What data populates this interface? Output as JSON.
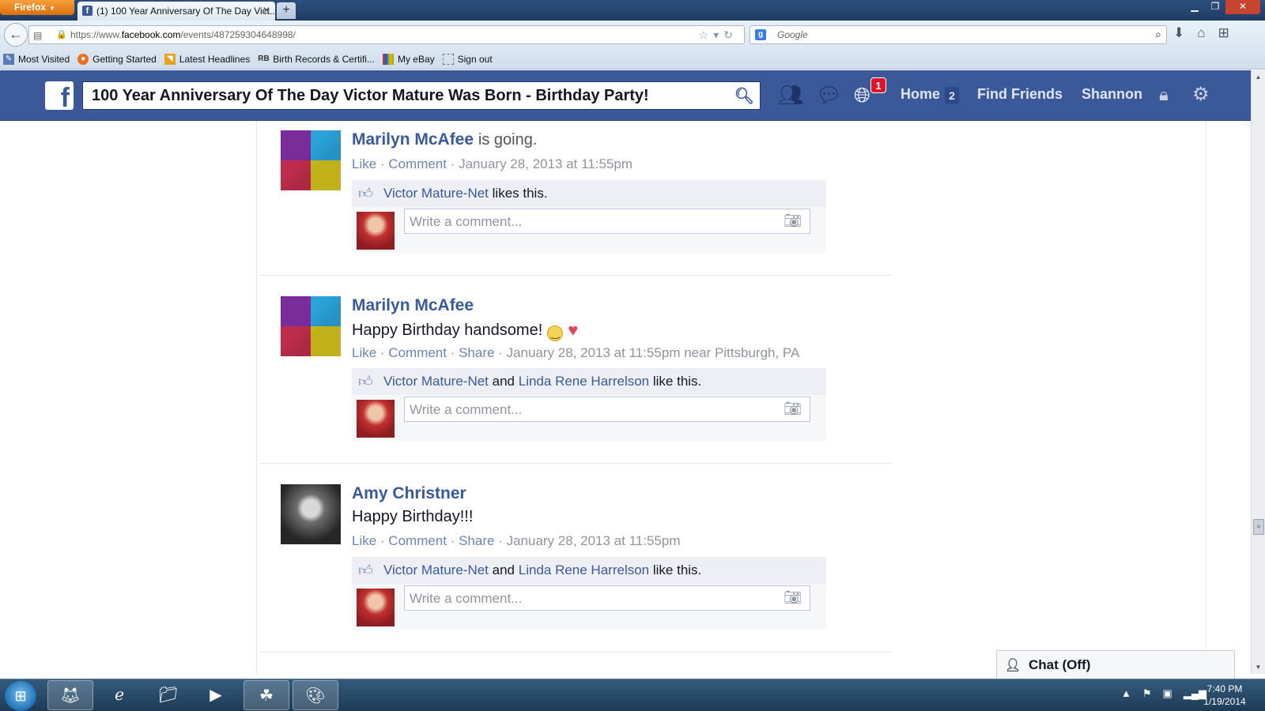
{
  "browser": {
    "menu_label": "Firefox",
    "tab_title": "(1) 100 Year Anniversary Of The Day Vict...",
    "new_tab": "+",
    "url_prefix": "https://www.",
    "url_domain": "facebook.com",
    "url_path": "/events/487259304648998/",
    "search_placeholder": "Google",
    "bookmarks": [
      {
        "label": "Most Visited",
        "icon": "most-visited-icon"
      },
      {
        "label": "Getting Started",
        "icon": "firefox-icon"
      },
      {
        "label": "Latest Headlines",
        "icon": "rss-icon"
      },
      {
        "label": "Birth Records & Certifi...",
        "icon": "rb-icon"
      },
      {
        "label": "My eBay",
        "icon": "ebay-icon"
      },
      {
        "label": "Sign out",
        "icon": "page-icon"
      }
    ]
  },
  "facebook": {
    "search_value": "100 Year Anniversary Of The Day Victor Mature Was Born - Birthday Party!",
    "notif_count": "1",
    "nav": {
      "home": "Home",
      "home_count": "2",
      "find_friends": "Find Friends",
      "profile": "Shannon"
    }
  },
  "posts": [
    {
      "author": "Marilyn McAfee",
      "status_suffix": "is going.",
      "text": "",
      "actions": {
        "like": "Like",
        "comment": "Comment"
      },
      "timestamp": "January 28, 2013 at 11:55pm",
      "likers": [
        "Victor Mature-Net"
      ],
      "likes_suffix": "likes this.",
      "comment_placeholder": "Write a comment..."
    },
    {
      "author": "Marilyn McAfee",
      "text": "Happy Birthday handsome!",
      "actions": {
        "like": "Like",
        "comment": "Comment",
        "share": "Share"
      },
      "timestamp": "January 28, 2013 at 11:55pm near Pittsburgh, PA",
      "likers": [
        "Victor Mature-Net",
        "Linda Rene Harrelson"
      ],
      "likes_joiner": "and",
      "likes_suffix": "like this.",
      "comment_placeholder": "Write a comment..."
    },
    {
      "author": "Amy Christner",
      "text": "Happy Birthday!!!",
      "actions": {
        "like": "Like",
        "comment": "Comment",
        "share": "Share"
      },
      "timestamp": "January 28, 2013 at 11:55pm",
      "likers": [
        "Victor Mature-Net",
        "Linda Rene Harrelson"
      ],
      "likes_joiner": "and",
      "likes_suffix": "like this.",
      "comment_placeholder": "Write a comment..."
    }
  ],
  "chat": {
    "label": "Chat (Off)"
  },
  "taskbar": {
    "time": "7:40 PM",
    "date": "1/19/2014"
  },
  "colors": {
    "fb_blue": "#3b5998",
    "link": "#3b5998",
    "meta": "#90949c"
  }
}
